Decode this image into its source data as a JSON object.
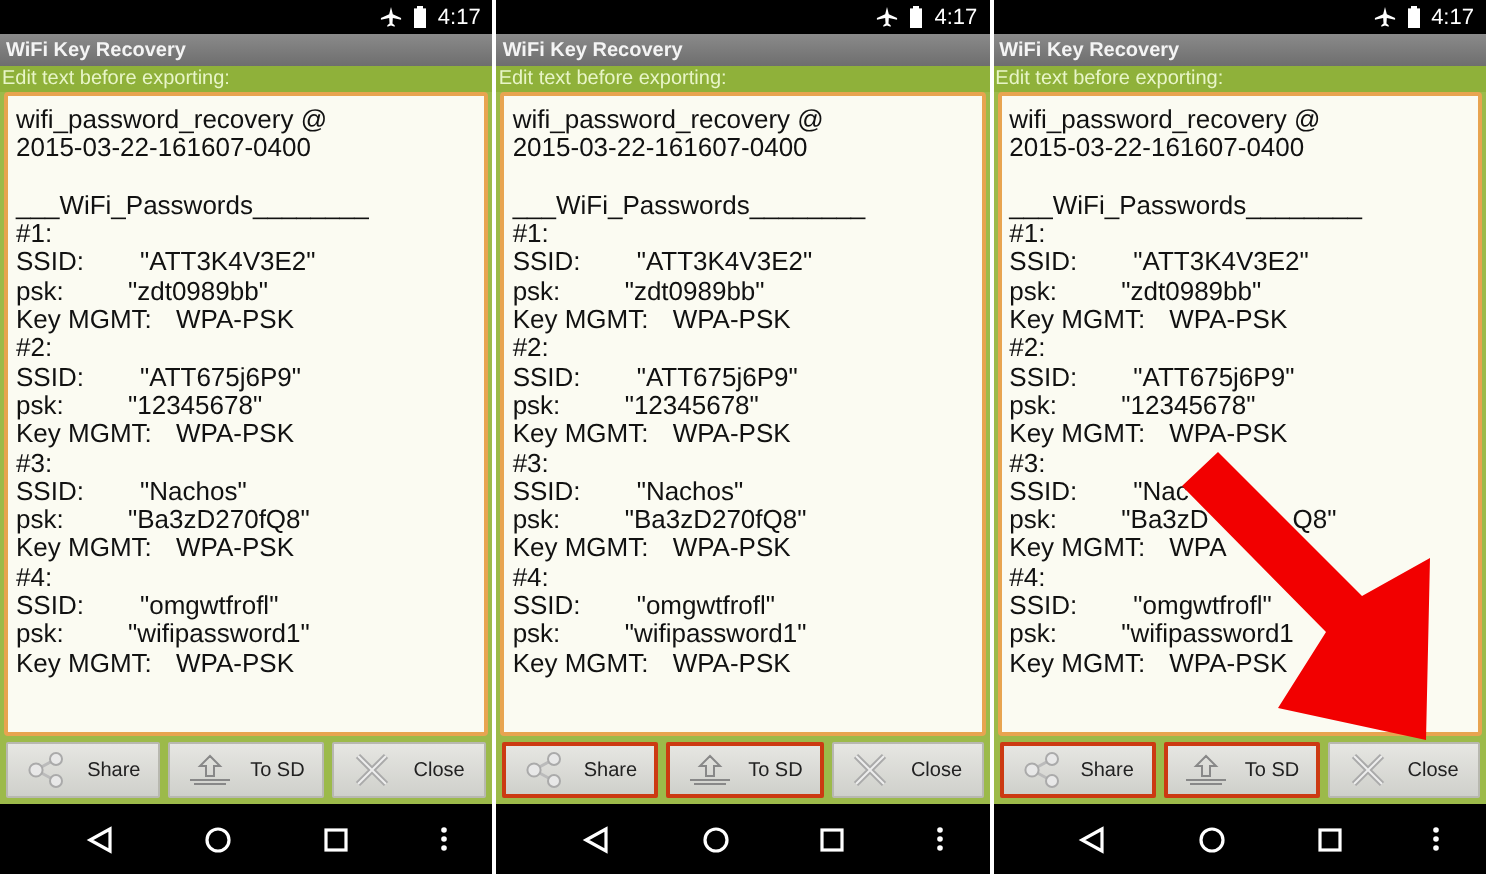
{
  "panels": [
    {
      "time": "4:17",
      "title": "WiFi Key Recovery",
      "prompt": "Edit text before exporting:",
      "callout_arrow": false,
      "lines": [
        {
          "kind": "text",
          "label": "wifi_password_recovery @"
        },
        {
          "kind": "text",
          "label": "2015-03-22-161607-0400"
        },
        {
          "kind": "blank"
        },
        {
          "kind": "text",
          "label": "___WiFi_Passwords________"
        },
        {
          "kind": "text",
          "label": "#1:"
        },
        {
          "kind": "ssid",
          "label": "SSID:",
          "value": "\"ATT3K4V3E2\""
        },
        {
          "kind": "psk",
          "label": "psk:",
          "value": "\"zdt0989bb\""
        },
        {
          "kind": "mgmt",
          "label": "Key MGMT:",
          "value": "WPA-PSK"
        },
        {
          "kind": "text",
          "label": "#2:"
        },
        {
          "kind": "ssid",
          "label": "SSID:",
          "value": "\"ATT675j6P9\""
        },
        {
          "kind": "psk",
          "label": "psk:",
          "value": "\"12345678\""
        },
        {
          "kind": "mgmt",
          "label": "Key MGMT:",
          "value": "WPA-PSK"
        },
        {
          "kind": "text",
          "label": "#3:"
        },
        {
          "kind": "ssid",
          "label": "SSID:",
          "value": "\"Nachos\""
        },
        {
          "kind": "psk",
          "label": "psk:",
          "value": "\"Ba3zD270fQ8\""
        },
        {
          "kind": "mgmt",
          "label": "Key MGMT:",
          "value": "WPA-PSK"
        },
        {
          "kind": "text",
          "label": "#4:"
        },
        {
          "kind": "ssid",
          "label": "SSID:",
          "value": "\"omgwtfrofl\""
        },
        {
          "kind": "psk",
          "label": "psk:",
          "value": "\"wifipassword1\""
        },
        {
          "kind": "mgmt",
          "label": "Key MGMT:",
          "value": "WPA-PSK"
        }
      ],
      "buttons": [
        {
          "kind": "share",
          "label": "Share",
          "selected": false
        },
        {
          "kind": "sd",
          "label": "To SD",
          "selected": false
        },
        {
          "kind": "close",
          "label": "Close",
          "selected": false
        }
      ]
    },
    {
      "time": "4:17",
      "title": "WiFi Key Recovery",
      "prompt": "Edit text before exporting:",
      "callout_arrow": false,
      "lines": [
        {
          "kind": "text",
          "label": "wifi_password_recovery @"
        },
        {
          "kind": "text",
          "label": "2015-03-22-161607-0400"
        },
        {
          "kind": "blank"
        },
        {
          "kind": "text",
          "label": "___WiFi_Passwords________"
        },
        {
          "kind": "text",
          "label": "#1:"
        },
        {
          "kind": "ssid",
          "label": "SSID:",
          "value": "\"ATT3K4V3E2\""
        },
        {
          "kind": "psk",
          "label": "psk:",
          "value": "\"zdt0989bb\""
        },
        {
          "kind": "mgmt",
          "label": "Key MGMT:",
          "value": "WPA-PSK"
        },
        {
          "kind": "text",
          "label": "#2:"
        },
        {
          "kind": "ssid",
          "label": "SSID:",
          "value": "\"ATT675j6P9\""
        },
        {
          "kind": "psk",
          "label": "psk:",
          "value": "\"12345678\""
        },
        {
          "kind": "mgmt",
          "label": "Key MGMT:",
          "value": "WPA-PSK"
        },
        {
          "kind": "text",
          "label": "#3:"
        },
        {
          "kind": "ssid",
          "label": "SSID:",
          "value": "\"Nachos\""
        },
        {
          "kind": "psk",
          "label": "psk:",
          "value": "\"Ba3zD270fQ8\""
        },
        {
          "kind": "mgmt",
          "label": "Key MGMT:",
          "value": "WPA-PSK"
        },
        {
          "kind": "text",
          "label": "#4:"
        },
        {
          "kind": "ssid",
          "label": "SSID:",
          "value": "\"omgwtfrofl\""
        },
        {
          "kind": "psk",
          "label": "psk:",
          "value": "\"wifipassword1\""
        },
        {
          "kind": "mgmt",
          "label": "Key MGMT:",
          "value": "WPA-PSK"
        }
      ],
      "buttons": [
        {
          "kind": "share",
          "label": "Share",
          "selected": true
        },
        {
          "kind": "sd",
          "label": "To SD",
          "selected": true
        },
        {
          "kind": "close",
          "label": "Close",
          "selected": false
        }
      ]
    },
    {
      "time": "4:17",
      "title": "WiFi Key Recovery",
      "prompt": "Edit text before exporting:",
      "callout_arrow": true,
      "lines": [
        {
          "kind": "text",
          "label": "wifi_password_recovery @"
        },
        {
          "kind": "text",
          "label": "2015-03-22-161607-0400"
        },
        {
          "kind": "blank"
        },
        {
          "kind": "text",
          "label": "___WiFi_Passwords________"
        },
        {
          "kind": "text",
          "label": "#1:"
        },
        {
          "kind": "ssid",
          "label": "SSID:",
          "value": "\"ATT3K4V3E2\""
        },
        {
          "kind": "psk",
          "label": "psk:",
          "value": "\"zdt0989bb\""
        },
        {
          "kind": "mgmt",
          "label": "Key MGMT:",
          "value": "WPA-PSK"
        },
        {
          "kind": "text",
          "label": "#2:"
        },
        {
          "kind": "ssid",
          "label": "SSID:",
          "value": "\"ATT675j6P9\""
        },
        {
          "kind": "psk",
          "label": "psk:",
          "value": "\"12345678\""
        },
        {
          "kind": "mgmt",
          "label": "Key MGMT:",
          "value": "WPA-PSK"
        },
        {
          "kind": "text",
          "label": "#3:"
        },
        {
          "kind": "ssid",
          "label": "SSID:",
          "value": "\"Nac"
        },
        {
          "kind": "psk",
          "label": "psk:",
          "value": "\"Ba3zD",
          "tail": "Q8\""
        },
        {
          "kind": "mgmt",
          "label": "Key MGMT:",
          "value": "WPA"
        },
        {
          "kind": "text",
          "label": "#4:"
        },
        {
          "kind": "ssid",
          "label": "SSID:",
          "value": "\"omgwtfrofl\""
        },
        {
          "kind": "psk",
          "label": "psk:",
          "value": "\"wifipassword1"
        },
        {
          "kind": "mgmt",
          "label": "Key MGMT:",
          "value": "WPA-PSK"
        }
      ],
      "buttons": [
        {
          "kind": "share",
          "label": "Share",
          "selected": true
        },
        {
          "kind": "sd",
          "label": "To SD",
          "selected": true
        },
        {
          "kind": "close",
          "label": "Close",
          "selected": false
        }
      ]
    }
  ]
}
